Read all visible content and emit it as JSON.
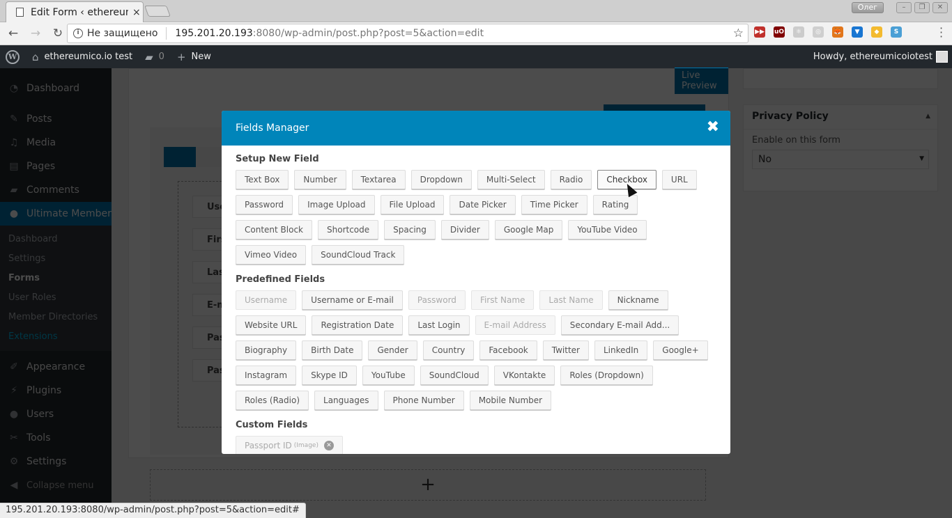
{
  "browser": {
    "tab_title": "Edit Form ‹ ethereumico.io test",
    "tab_close": "×",
    "window_user": "Олег",
    "window_buttons": [
      "–",
      "❐",
      "✕"
    ],
    "security_label": "Не защищено",
    "url_host": "195.201.20.193",
    "url_rest": ":8080/wp-admin/post.php?post=5&action=edit",
    "status_url": "195.201.20.193:8080/wp-admin/post.php?post=5&action=edit#",
    "extensions": [
      {
        "name": "video-speed-icon",
        "label": "▶▶",
        "color": "#c0302b"
      },
      {
        "name": "ublock-icon",
        "label": "uO",
        "color": "#800000"
      },
      {
        "name": "react-devtools-icon",
        "label": "⚛",
        "color": "#cccccc"
      },
      {
        "name": "circle-ext-icon",
        "label": "◎",
        "color": "#cfcfcf"
      },
      {
        "name": "metamask-icon",
        "label": "🦊",
        "color": "#e2761b"
      },
      {
        "name": "diamond-ext-icon",
        "label": "▼",
        "color": "#1976d2"
      },
      {
        "name": "binance-icon",
        "label": "◆",
        "color": "#f3ba2f"
      },
      {
        "name": "s-ext-icon",
        "label": "S",
        "color": "#4a9fd5"
      }
    ]
  },
  "adminbar": {
    "site_name": "ethereumico.io test",
    "comments_count": "0",
    "new_label": "New",
    "howdy": "Howdy, ethereumicoiotest"
  },
  "sidebar": {
    "items_top": [
      {
        "label": "Dashboard",
        "icon": "dashboard-icon",
        "glyph": "◔"
      }
    ],
    "items_mid": [
      {
        "label": "Posts",
        "icon": "pin-icon",
        "glyph": "✎"
      },
      {
        "label": "Media",
        "icon": "media-icon",
        "glyph": "♫"
      },
      {
        "label": "Pages",
        "icon": "pages-icon",
        "glyph": "▤"
      },
      {
        "label": "Comments",
        "icon": "comment-icon",
        "glyph": "▰"
      }
    ],
    "active": {
      "label": "Ultimate Member",
      "icon": "user-icon",
      "glyph": "●"
    },
    "submenu": [
      {
        "label": "Dashboard"
      },
      {
        "label": "Settings"
      },
      {
        "label": "Forms"
      },
      {
        "label": "User Roles"
      },
      {
        "label": "Member Directories"
      },
      {
        "label": "Extensions"
      }
    ],
    "items_bottom": [
      {
        "label": "Appearance",
        "icon": "brush-icon",
        "glyph": "✐"
      },
      {
        "label": "Plugins",
        "icon": "plugin-icon",
        "glyph": "⚡"
      },
      {
        "label": "Users",
        "icon": "users-icon",
        "glyph": "●"
      },
      {
        "label": "Tools",
        "icon": "wrench-icon",
        "glyph": "✂"
      },
      {
        "label": "Settings",
        "icon": "settings-icon",
        "glyph": "⚙"
      },
      {
        "label": "Collapse menu",
        "icon": "collapse-icon",
        "glyph": "◀"
      }
    ]
  },
  "main": {
    "live_preview": "Live Preview",
    "background_fields": [
      "Username",
      "First Name",
      "Last Name",
      "E-mail Address",
      "Password",
      "Password"
    ],
    "add_row": "+",
    "privacy": {
      "title": "Privacy Policy",
      "label": "Enable on this form",
      "value": "No"
    }
  },
  "modal": {
    "title": "Fields Manager",
    "close": "✖",
    "sections": [
      {
        "title": "Setup New Field",
        "buttons": [
          {
            "label": "Text Box"
          },
          {
            "label": "Number"
          },
          {
            "label": "Textarea"
          },
          {
            "label": "Dropdown"
          },
          {
            "label": "Multi-Select"
          },
          {
            "label": "Radio"
          },
          {
            "label": "Checkbox",
            "state": "active"
          },
          {
            "label": "URL"
          },
          {
            "label": "Password"
          },
          {
            "label": "Image Upload"
          },
          {
            "label": "File Upload"
          },
          {
            "label": "Date Picker"
          },
          {
            "label": "Time Picker"
          },
          {
            "label": "Rating"
          },
          {
            "label": "Content Block"
          },
          {
            "label": "Shortcode"
          },
          {
            "label": "Spacing"
          },
          {
            "label": "Divider"
          },
          {
            "label": "Google Map"
          },
          {
            "label": "YouTube Video"
          },
          {
            "label": "Vimeo Video"
          },
          {
            "label": "SoundCloud Track"
          }
        ]
      },
      {
        "title": "Predefined Fields",
        "buttons": [
          {
            "label": "Username",
            "state": "disabled"
          },
          {
            "label": "Username or E-mail"
          },
          {
            "label": "Password",
            "state": "disabled"
          },
          {
            "label": "First Name",
            "state": "disabled"
          },
          {
            "label": "Last Name",
            "state": "disabled"
          },
          {
            "label": "Nickname"
          },
          {
            "label": "Website URL"
          },
          {
            "label": "Registration Date"
          },
          {
            "label": "Last Login"
          },
          {
            "label": "E-mail Address",
            "state": "disabled"
          },
          {
            "label": "Secondary E-mail Add..."
          },
          {
            "label": "Biography"
          },
          {
            "label": "Birth Date"
          },
          {
            "label": "Gender"
          },
          {
            "label": "Country"
          },
          {
            "label": "Facebook"
          },
          {
            "label": "Twitter"
          },
          {
            "label": "LinkedIn"
          },
          {
            "label": "Google+"
          },
          {
            "label": "Instagram"
          },
          {
            "label": "Skype ID"
          },
          {
            "label": "YouTube"
          },
          {
            "label": "SoundCloud"
          },
          {
            "label": "VKontakte"
          },
          {
            "label": "Roles (Dropdown)"
          },
          {
            "label": "Roles (Radio)"
          },
          {
            "label": "Languages"
          },
          {
            "label": "Phone Number"
          },
          {
            "label": "Mobile Number"
          }
        ]
      }
    ],
    "custom": {
      "title": "Custom Fields",
      "fields": [
        {
          "label": "Passport ID",
          "type": "(Image)"
        }
      ]
    }
  }
}
